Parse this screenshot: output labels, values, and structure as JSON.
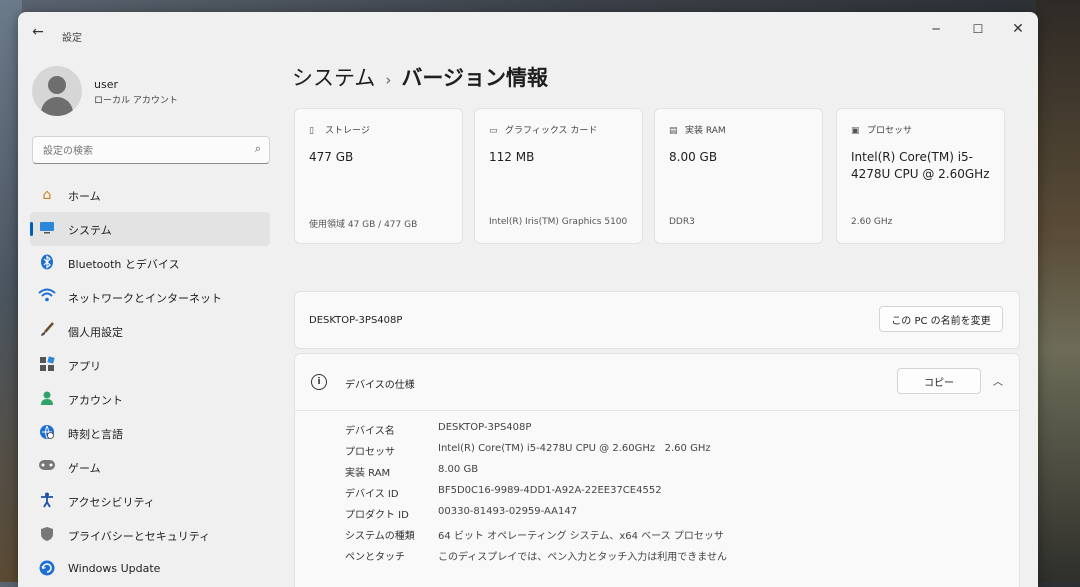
{
  "window": {
    "title": "設定"
  },
  "profile": {
    "name": "user",
    "account_type": "ローカル アカウント"
  },
  "search": {
    "placeholder": "設定の検索"
  },
  "nav": {
    "items": [
      {
        "label": "ホーム",
        "icon": "home-icon"
      },
      {
        "label": "システム",
        "icon": "monitor-icon",
        "active": true
      },
      {
        "label": "Bluetooth とデバイス",
        "icon": "bluetooth-icon"
      },
      {
        "label": "ネットワークとインターネット",
        "icon": "wifi-icon"
      },
      {
        "label": "個人用設定",
        "icon": "brush-icon"
      },
      {
        "label": "アプリ",
        "icon": "apps-icon"
      },
      {
        "label": "アカウント",
        "icon": "person-icon"
      },
      {
        "label": "時刻と言語",
        "icon": "globe-clock-icon"
      },
      {
        "label": "ゲーム",
        "icon": "gamepad-icon"
      },
      {
        "label": "アクセシビリティ",
        "icon": "accessibility-icon"
      },
      {
        "label": "プライバシーとセキュリティ",
        "icon": "shield-icon"
      },
      {
        "label": "Windows Update",
        "icon": "update-icon"
      }
    ]
  },
  "breadcrumb": {
    "parent": "システム",
    "current": "バージョン情報"
  },
  "cards": [
    {
      "label": "ストレージ",
      "icon": "storage-icon",
      "value": "477 GB",
      "sub": "使用領域 47 GB / 477 GB"
    },
    {
      "label": "グラフィックス カード",
      "icon": "gpu-icon",
      "value": "112 MB",
      "sub": "Intel(R) Iris(TM) Graphics 5100"
    },
    {
      "label": "実装 RAM",
      "icon": "ram-icon",
      "value": "8.00 GB",
      "sub": "DDR3"
    },
    {
      "label": "プロセッサ",
      "icon": "cpu-icon",
      "value": "Intel(R) Core(TM) i5-4278U CPU @ 2.60GHz",
      "sub": "2.60 GHz"
    }
  ],
  "device": {
    "name": "DESKTOP-3PS408P",
    "rename_label": "この PC の名前を変更"
  },
  "specs": {
    "title": "デバイスの仕様",
    "copy_label": "コピー",
    "rows": [
      {
        "key": "デバイス名",
        "value": "DESKTOP-3PS408P"
      },
      {
        "key": "プロセッサ",
        "value": "Intel(R) Core(TM) i5-4278U CPU @ 2.60GHz   2.60 GHz"
      },
      {
        "key": "実装 RAM",
        "value": "8.00 GB"
      },
      {
        "key": "デバイス ID",
        "value": "BF5D0C16-9989-4DD1-A92A-22EE37CE4552"
      },
      {
        "key": "プロダクト ID",
        "value": "00330-81493-02959-AA147"
      },
      {
        "key": "システムの種類",
        "value": "64 ビット オペレーティング システム、x64 ベース プロセッサ"
      },
      {
        "key": "ペンとタッチ",
        "value": "このディスプレイでは、ペン入力とタッチ入力は利用できません"
      }
    ]
  },
  "colors": {
    "accent": "#005fb8",
    "window_bg": "#f1f0f0",
    "card_bg": "#f9f9f9"
  }
}
